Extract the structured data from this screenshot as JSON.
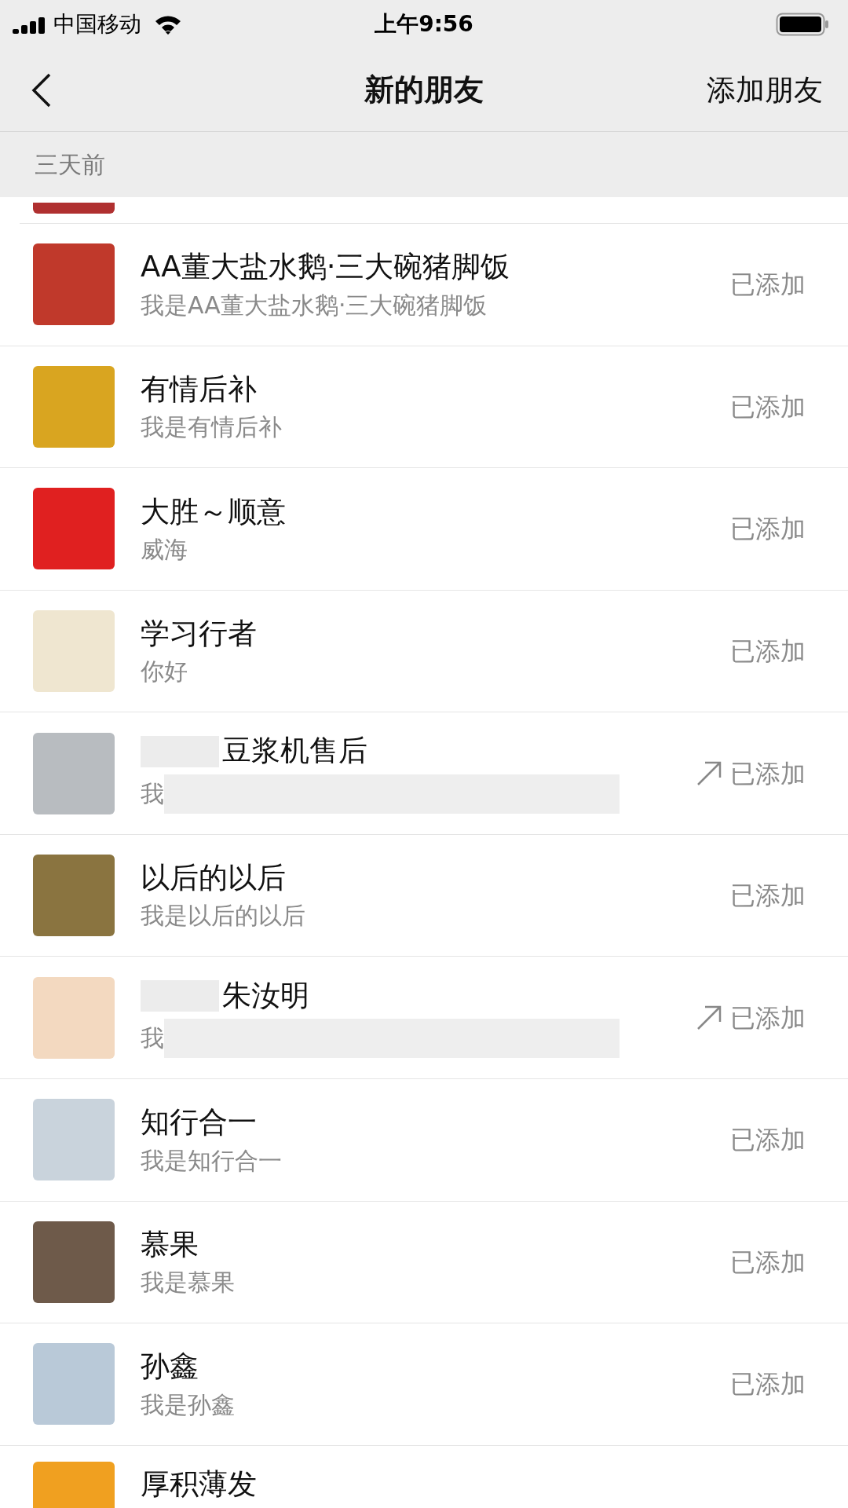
{
  "status_bar": {
    "carrier": "中国移动",
    "time": "上午9:56"
  },
  "nav": {
    "title": "新的朋友",
    "action": "添加朋友"
  },
  "section": {
    "label": "三天前"
  },
  "rows": [
    {
      "name": "AA董大盐水鹅·三大碗猪脚饭",
      "message": "我是AA董大盐水鹅·三大碗猪脚饭",
      "status": "已添加",
      "outgoing": false,
      "blurred": false
    },
    {
      "name": "有情后补",
      "message": "我是有情后补",
      "status": "已添加",
      "outgoing": false,
      "blurred": false
    },
    {
      "name": "大胜～顺意",
      "message": "威海",
      "status": "已添加",
      "outgoing": false,
      "blurred": false
    },
    {
      "name": "学习行者",
      "message": "你好",
      "status": "已添加",
      "outgoing": false,
      "blurred": false
    },
    {
      "name": "豆浆机售后",
      "message": "我",
      "status": "已添加",
      "outgoing": true,
      "blurred": true
    },
    {
      "name": "以后的以后",
      "message": "我是以后的以后",
      "status": "已添加",
      "outgoing": false,
      "blurred": false
    },
    {
      "name": "朱汝明",
      "message": "我",
      "status": "已添加",
      "outgoing": true,
      "blurred": true
    },
    {
      "name": "知行合一",
      "message": "我是知行合一",
      "status": "已添加",
      "outgoing": false,
      "blurred": false
    },
    {
      "name": "慕果",
      "message": "我是慕果",
      "status": "已添加",
      "outgoing": false,
      "blurred": false
    },
    {
      "name": "孙鑫",
      "message": "我是孙鑫",
      "status": "已添加",
      "outgoing": false,
      "blurred": false
    }
  ],
  "last_row": {
    "name": "厚积薄发"
  }
}
